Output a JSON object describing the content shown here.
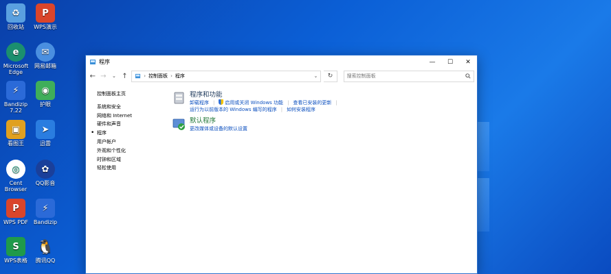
{
  "desktop": {
    "icons": [
      {
        "label": "回收站",
        "icon": "recycle-bin-icon",
        "color": "#5aa0e0"
      },
      {
        "label": "WPS演示",
        "icon": "wps-presentation-icon",
        "color": "#d9452b"
      },
      {
        "label": "Microsoft Edge",
        "icon": "edge-icon",
        "color": "#1b8f6e"
      },
      {
        "label": "网易邮箱",
        "icon": "mail-icon",
        "color": "#4a8fe0"
      },
      {
        "label": "Bandizip 7.22",
        "icon": "bandizip-icon",
        "color": "#2b6ad8"
      },
      {
        "label": "护眼",
        "icon": "eye-icon",
        "color": "#3fae5a"
      },
      {
        "label": "看图王",
        "icon": "image-viewer-icon",
        "color": "#e0a020"
      },
      {
        "label": "迅雷",
        "icon": "thunder-icon",
        "color": "#2a7de0"
      },
      {
        "label": "Cent Browser",
        "icon": "cent-browser-icon",
        "color": "#ffffff"
      },
      {
        "label": "QQ影音",
        "icon": "qq-player-icon",
        "color": "#1a3f9a"
      },
      {
        "label": "WPS PDF",
        "icon": "wps-pdf-icon",
        "color": "#d9452b"
      },
      {
        "label": "Bandizip",
        "icon": "bandizip-icon",
        "color": "#2b6ad8"
      },
      {
        "label": "WPS表格",
        "icon": "wps-sheet-icon",
        "color": "#1f9a4a"
      },
      {
        "label": "腾讯QQ",
        "icon": "qq-icon",
        "color": "#111111"
      }
    ]
  },
  "window": {
    "title": "程序",
    "address": {
      "root": "控制面板",
      "current": "程序"
    },
    "search_placeholder": "搜索控制面板"
  },
  "sidebar": {
    "home": "控制面板主页",
    "items": [
      "系统和安全",
      "网络和 Internet",
      "硬件和声音",
      "程序",
      "用户帐户",
      "外观和个性化",
      "时钟和区域",
      "轻松使用"
    ],
    "current_index": 3
  },
  "categories": [
    {
      "title": "程序和功能",
      "links": [
        "卸载程序",
        "启用或关闭 Windows 功能",
        "查看已安装的更新",
        "运行为以前版本的 Windows 编写的程序",
        "如何安装程序"
      ]
    },
    {
      "title": "默认程序",
      "links": [
        "更改媒体或设备的默认设置"
      ]
    }
  ]
}
